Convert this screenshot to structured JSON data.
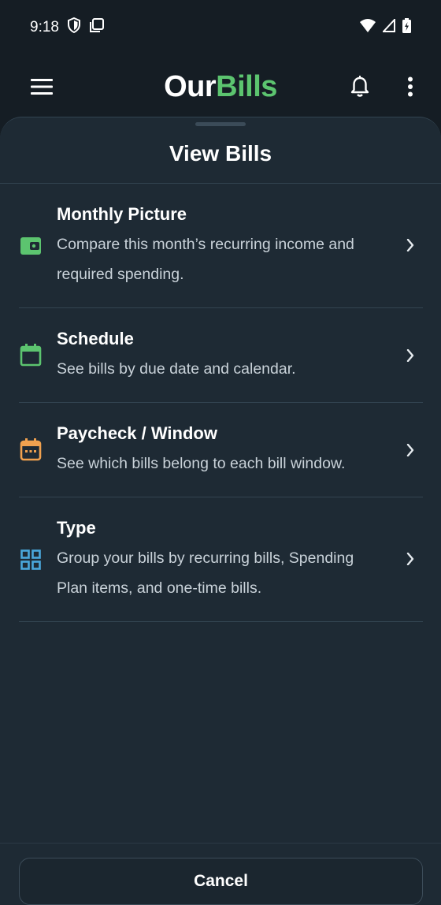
{
  "status_bar": {
    "time": "9:18"
  },
  "app_bar": {
    "title_part1": "Our",
    "title_part2": "Bills"
  },
  "sheet": {
    "title": "View Bills",
    "options": [
      {
        "title": "Monthly Picture",
        "description": "Compare this month’s recurring income and required spending.",
        "icon": "wallet-icon",
        "icon_color": "#5cc46f"
      },
      {
        "title": "Schedule",
        "description": "See bills by due date and calendar.",
        "icon": "calendar-icon",
        "icon_color": "#5cc46f"
      },
      {
        "title": "Paycheck / Window",
        "description": "See which bills belong to each bill window.",
        "icon": "calendar-window-icon",
        "icon_color": "#f0a14f"
      },
      {
        "title": "Type",
        "description": "Group your bills by recurring bills, Spending Plan items, and one-time bills.",
        "icon": "grid-icon",
        "icon_color": "#4aa8dc"
      }
    ],
    "cancel_label": "Cancel"
  },
  "colors": {
    "background": "#151d24",
    "sheet": "#1e2a34",
    "accent_green": "#5cc46f",
    "accent_orange": "#f0a14f",
    "accent_blue": "#4aa8dc"
  }
}
